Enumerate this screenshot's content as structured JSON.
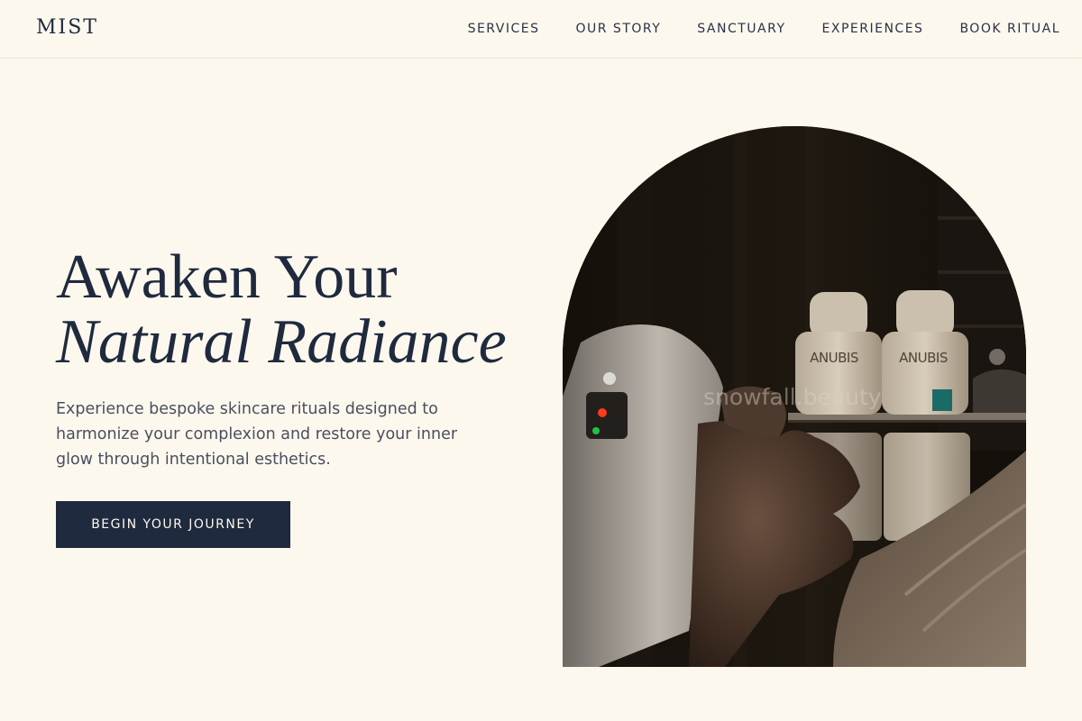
{
  "brand": {
    "logo": "MIST"
  },
  "nav": {
    "items": [
      {
        "label": "SERVICES"
      },
      {
        "label": "OUR STORY"
      },
      {
        "label": "SANCTUARY"
      },
      {
        "label": "EXPERIENCES"
      },
      {
        "label": "BOOK RITUAL"
      }
    ]
  },
  "hero": {
    "title_line1": "Awaken Your",
    "title_line2": "Natural Radiance",
    "description": "Experience bespoke skincare rituals designed to harmonize your complexion and restore your inner glow through intentional esthetics.",
    "cta_label": "BEGIN YOUR JOURNEY",
    "image": {
      "bottle_brand": "ANUBIS",
      "watermark": "snowfall.beauty"
    }
  },
  "colors": {
    "background": "#fdf8ee",
    "primary": "#1f2a3e",
    "text_muted": "#4a4f5e"
  }
}
